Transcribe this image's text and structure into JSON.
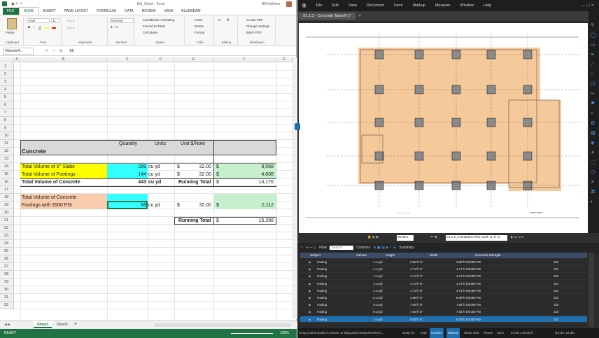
{
  "excel": {
    "title": "Bid_Sheet - Excel",
    "user": "Bill Kelleher",
    "tabs": [
      "FILE",
      "HOME",
      "INSERT",
      "PAGE LAYOUT",
      "FORMULAS",
      "DATA",
      "REVIEW",
      "VIEW",
      "BLUEBEAM"
    ],
    "ribbon": {
      "paste": "Paste",
      "font_name": "Arial",
      "font_size": "11",
      "font_bold": "B",
      "font_italic": "I",
      "font_underline": "U",
      "number_format": "General",
      "currency_btn": "$ - %",
      "cond_format": "Conditional Formatting",
      "format_table": "Format as Table",
      "cell_styles": "Cell Styles",
      "insert": "Insert",
      "delete": "Delete",
      "format": "Format",
      "create_pdf": "Create PDF",
      "change_settings": "Change Settings",
      "batch_pdf": "Batch PDF",
      "groups": [
        "Clipboard",
        "Font",
        "Alignment",
        "Number",
        "Styles",
        "Cells",
        "Editing",
        "Bluebeam"
      ]
    },
    "namebox": "Volume4...",
    "formula_fx": "fx",
    "formula_value": "66",
    "columns": [
      "A",
      "B",
      "C",
      "D",
      "E",
      "F",
      "G"
    ],
    "rows": [
      "1",
      "2",
      "3",
      "4",
      "5",
      "6",
      "7",
      "8",
      "9",
      "10",
      "11",
      "12",
      "13",
      "14",
      "15",
      "16",
      "17",
      "18",
      "19",
      "20",
      "21",
      "22",
      "23",
      "24",
      "25",
      "26",
      "27",
      "28",
      "29",
      "30",
      "31",
      "32"
    ],
    "table": {
      "h_qty": "Quantity",
      "h_units": "Units",
      "h_unit_cost": "Unit $/Note",
      "section": "Concrete",
      "r6_label": "Total Volume of 6\" Slabs",
      "r6_qty": "299",
      "r6_units": "cu yd",
      "r6_dollar": "$",
      "r6_cost": "32.00",
      "r6_dollar2": "$",
      "r6_total": "9,568",
      "r7_label": "Total Volume of Footings",
      "r7_qty": "144",
      "r7_units": "cu yd",
      "r7_dollar": "$",
      "r7_cost": "32.00",
      "r7_dollar2": "$",
      "r7_total": "4,608",
      "r8_label": "Total Volume of Concrete",
      "r8_qty": "443",
      "r8_units": "cu yd",
      "r8_running": "Running Total",
      "r8_dollar": "$",
      "r8_total": "14,176",
      "r9_label": "Total Volume of Concrete",
      "r10_label": "Footings with 3500 PSI",
      "r10_qty": "66",
      "r10_units": "cu yd",
      "r10_dollar": "$",
      "r10_cost": "32.00",
      "r10_dollar2": "$",
      "r10_total": "2,112",
      "r12_running": "Running Total",
      "r12_dollar": "$",
      "r12_total": "16,288"
    },
    "sheets": [
      "Sheet1",
      "Sheet2"
    ],
    "status": "READY",
    "zoom": "120%"
  },
  "bluebeam": {
    "menu": [
      "File",
      "Edit",
      "View",
      "Document",
      "Form",
      "Markup",
      "Measure",
      "Window",
      "Help"
    ],
    "doc_tab": "S1.1.2 - Concrete Takeoff 1*",
    "zoom": "26.85%",
    "page": "S1.1.2_Foundation Plan North (1 of 1)",
    "markups_bar": {
      "filter": "Filter",
      "search": "Search",
      "columns": "Columns",
      "summary": "Summary"
    },
    "markup_headers": [
      "Subject",
      "Volume",
      "Height",
      "Width",
      "Concrete Strength"
    ],
    "markups": [
      {
        "subject": "Footing",
        "volume": "1 cu yd",
        "height": "3.50 ft' in\"",
        "width": "3.50 ft' in\"",
        "strength": "4,000 PSI",
        "extra": "120"
      },
      {
        "subject": "Footing",
        "volume": "1 cu yd",
        "height": "4.71 ft' in\"",
        "width": "4.71 ft' in\"",
        "strength": "3,500 PSI",
        "extra": "110"
      },
      {
        "subject": "Footing",
        "volume": "1 cu yd",
        "height": "4.71 ft' in\"",
        "width": "4.71 ft' in\"",
        "strength": "4,000 PSI",
        "extra": "120"
      },
      {
        "subject": "Footing",
        "volume": "1 cu yd",
        "height": "4.71 ft' in\"",
        "width": "4.71 ft' in\"",
        "strength": "3,500 PSI",
        "extra": "110"
      },
      {
        "subject": "Footing",
        "volume": "1 cu yd",
        "height": "4.71 ft' in\"",
        "width": "4.71 ft' in\"",
        "strength": "4,000 PSI",
        "extra": "120"
      },
      {
        "subject": "Footing",
        "volume": "2 cu yd",
        "height": "4.96 ft' in\"",
        "width": "6.39 ft' in\"",
        "strength": "4,000 PSI",
        "extra": "120"
      },
      {
        "subject": "Footing",
        "volume": "3 cu yd",
        "height": "7.50 ft' in\"",
        "width": "7.50 ft' in\"",
        "strength": "4,000 PSI",
        "extra": "120"
      },
      {
        "subject": "Footing",
        "volume": "6 cu yd",
        "height": "7.50 ft' in\"",
        "width": "7.50 ft' in\"",
        "strength": "4,000 PSI",
        "extra": "120"
      },
      {
        "subject": "Footing",
        "volume": "1 cu yd",
        "height": "5.00 ft' in\"",
        "width": "5.00 ft' in\"",
        "strength": "3,500 PSI",
        "extra": "110"
      }
    ],
    "status_msg": "Drag control points to resize, or drag area measurement to...",
    "snap": "Snap To:",
    "status_items": [
      "Grid",
      "Content",
      "Markup",
      "Show Grid",
      "Reuse",
      "Sync"
    ],
    "dims": "42.00 x 30.00 in",
    "coords": "(12.83, 10.38)"
  },
  "colors": {
    "excel_green": "#217346",
    "yellow": "#ffff00",
    "cyan": "#33ffff",
    "peach": "#f8cbad",
    "light_green": "#c6efce",
    "gray_head": "#d9d9d9",
    "orange_zone": "#f4c089"
  }
}
